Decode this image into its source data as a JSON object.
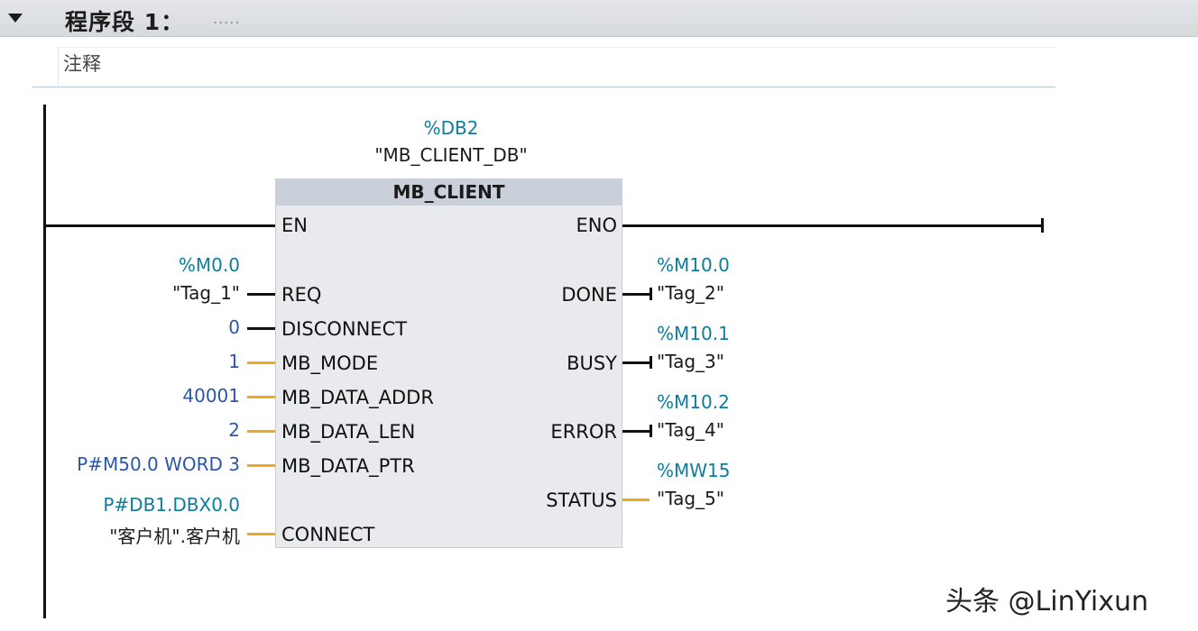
{
  "network": {
    "title": "程序段 1：",
    "title_placeholder": ".....",
    "comment": "注释"
  },
  "block": {
    "instance_address": "%DB2",
    "instance_name": "\"MB_CLIENT_DB\"",
    "type": "MB_CLIENT",
    "inputs": [
      {
        "pin": "EN",
        "address": "",
        "tag": "",
        "value": ""
      },
      {
        "pin": "REQ",
        "address": "%M0.0",
        "tag": "\"Tag_1\"",
        "value": ""
      },
      {
        "pin": "DISCONNECT",
        "address": "",
        "tag": "",
        "value": "0"
      },
      {
        "pin": "MB_MODE",
        "address": "",
        "tag": "",
        "value": "1"
      },
      {
        "pin": "MB_DATA_ADDR",
        "address": "",
        "tag": "",
        "value": "40001"
      },
      {
        "pin": "MB_DATA_LEN",
        "address": "",
        "tag": "",
        "value": "2"
      },
      {
        "pin": "MB_DATA_PTR",
        "address": "",
        "tag": "",
        "value": "P#M50.0 WORD 3"
      },
      {
        "pin": "CONNECT",
        "address": "P#DB1.DBX0.0",
        "tag": "\"客户机\".客户机",
        "value": ""
      }
    ],
    "outputs": [
      {
        "pin": "ENO",
        "address": "",
        "tag": ""
      },
      {
        "pin": "DONE",
        "address": "%M10.0",
        "tag": "\"Tag_2\""
      },
      {
        "pin": "BUSY",
        "address": "%M10.1",
        "tag": "\"Tag_3\""
      },
      {
        "pin": "ERROR",
        "address": "%M10.2",
        "tag": "\"Tag_4\""
      },
      {
        "pin": "STATUS",
        "address": "%MW15",
        "tag": "\"Tag_5\""
      }
    ]
  },
  "watermark": "头条 @LinYixun",
  "icons": {
    "collapse": "triangle-down-icon"
  },
  "colors": {
    "address": "#0e7d9b",
    "constant": "#2b57a8",
    "wire_bool": "#111111",
    "wire_data": "#f0a81c",
    "block_fill": "#e8eaee",
    "block_header": "#c9d0d9"
  }
}
